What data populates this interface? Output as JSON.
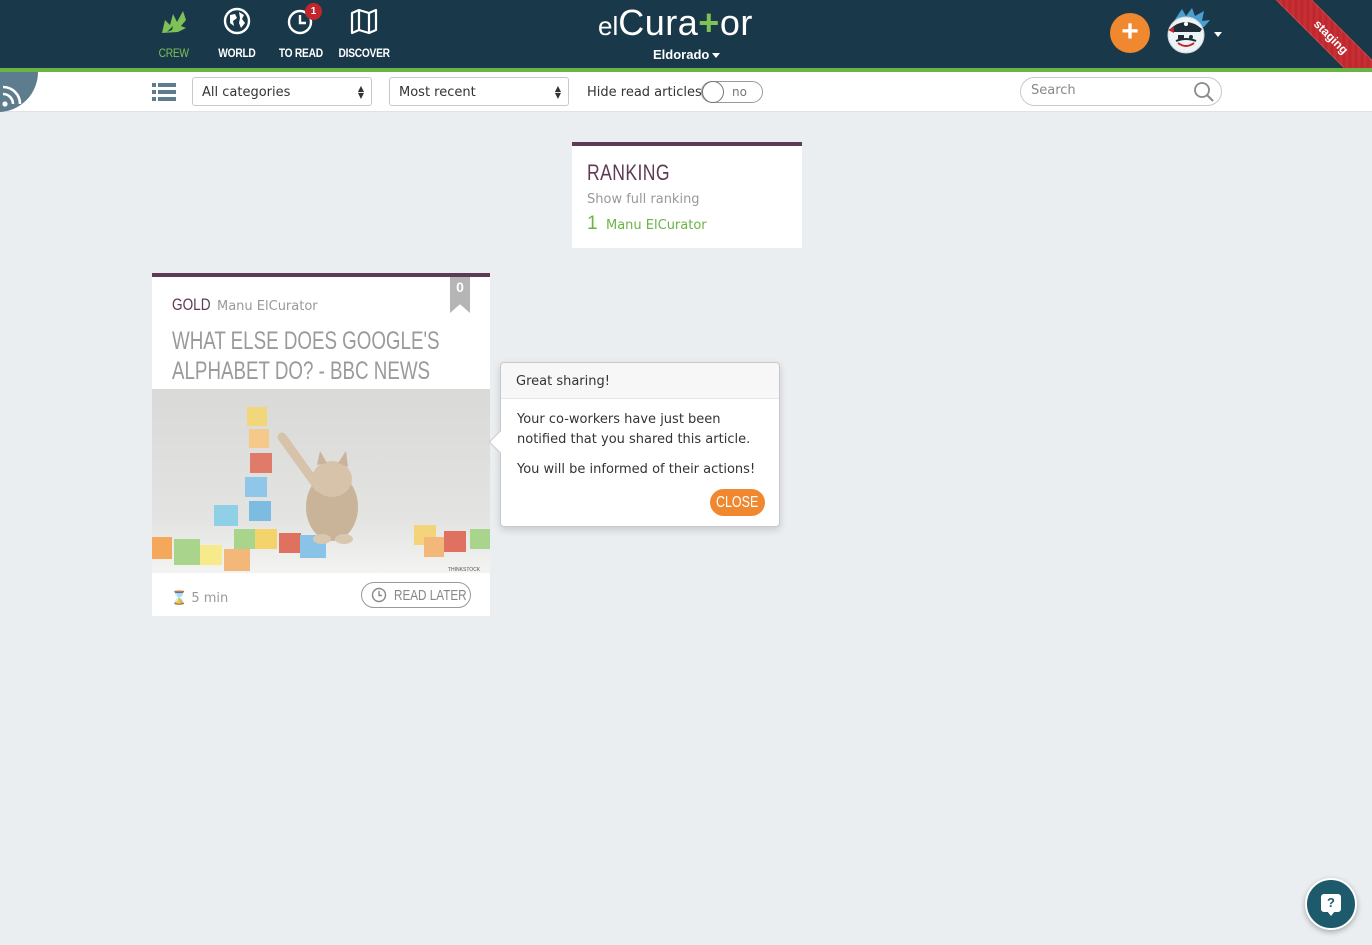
{
  "header": {
    "nav": [
      {
        "id": "crew",
        "label": "CREW",
        "icon": "crew-icon",
        "active": true
      },
      {
        "id": "world",
        "label": "WORLD",
        "icon": "globe-icon",
        "active": false
      },
      {
        "id": "to-read",
        "label": "TO READ",
        "icon": "clock-icon",
        "active": false,
        "badge": "1"
      },
      {
        "id": "discover",
        "label": "DISCOVER",
        "icon": "map-icon",
        "active": false
      }
    ],
    "logo_el": "el",
    "logo_cura": "Cura",
    "logo_plus": "+",
    "logo_or": "or",
    "workspace": "Eldorado",
    "add_label": "+",
    "ribbon": "staging"
  },
  "toolbar": {
    "category": "All categories",
    "sort": "Most recent",
    "hide_read_label": "Hide read articles",
    "hide_read_state": "no",
    "search_placeholder": "Search"
  },
  "ranking": {
    "title": "RANKING",
    "show_full": "Show full ranking",
    "entries": [
      {
        "position": "1",
        "name": "Manu ElCurator"
      }
    ]
  },
  "article": {
    "category": "GOLD",
    "author": "Manu ElCurator",
    "count": "0",
    "title": "What else does Google's Alphabet do? - BBC News",
    "duration": "5 min",
    "read_later": "READ LATER",
    "image_watermark": "THINKSTOCK"
  },
  "popover": {
    "title": "Great sharing!",
    "body1": "Your co-workers have just been notified that you shared this article.",
    "body2": "You will be informed of their actions!",
    "close": "CLOSE"
  },
  "help": {
    "label": "?"
  },
  "colors": {
    "header_bg": "#19394a",
    "accent_green": "#6ab445",
    "accent_orange": "#f0882f",
    "plum": "#5e3a55",
    "ribbon_red": "#c0262c"
  }
}
